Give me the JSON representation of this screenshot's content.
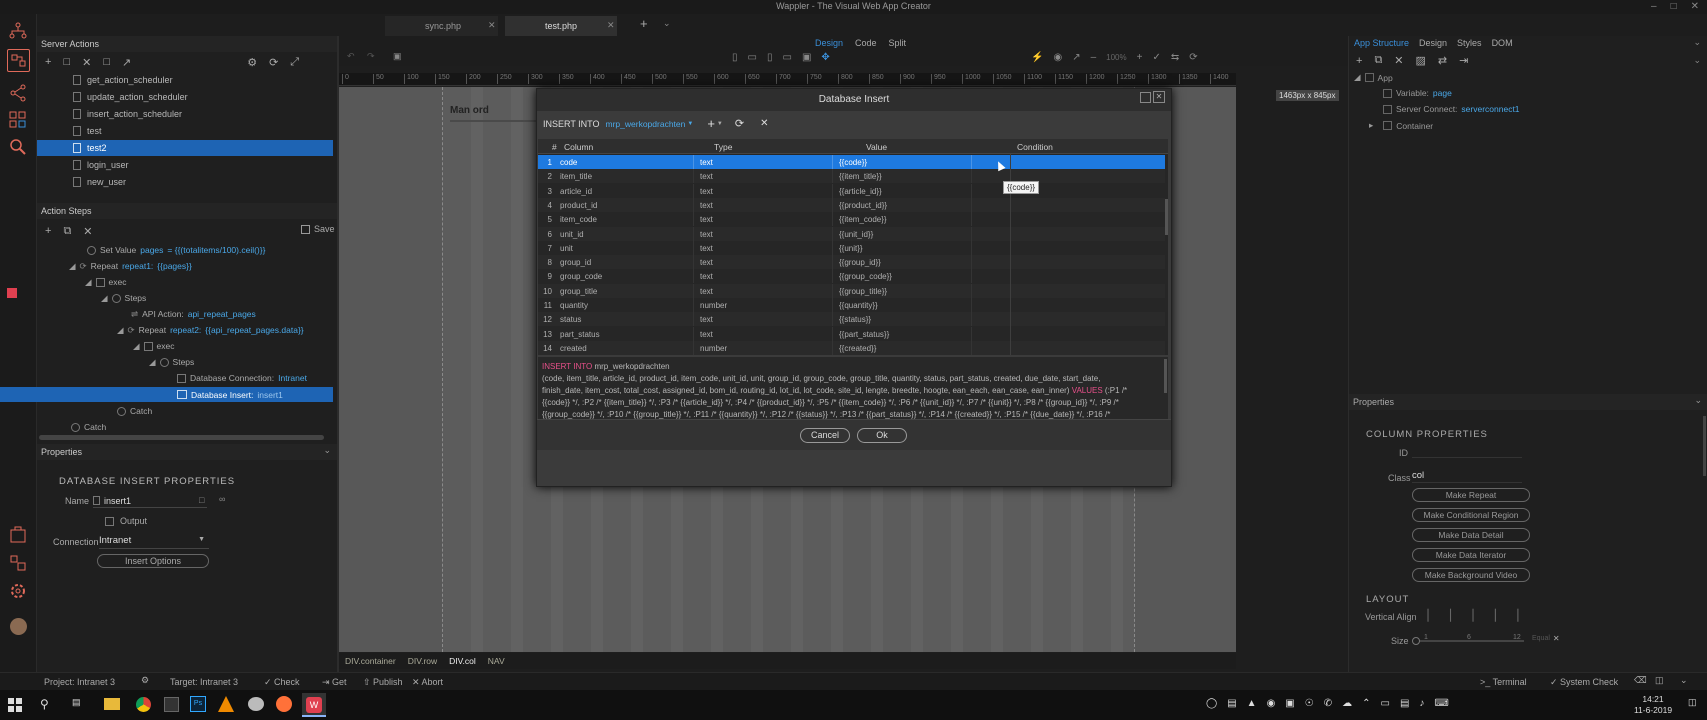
{
  "window": {
    "title": "Wappler - The Visual Web App Creator"
  },
  "tabs": [
    {
      "label": "sync.php"
    },
    {
      "label": "test.php"
    }
  ],
  "left_panel": {
    "title": "Server Actions",
    "tree_items": [
      {
        "label": "get_action_scheduler"
      },
      {
        "label": "update_action_scheduler"
      },
      {
        "label": "insert_action_scheduler"
      },
      {
        "label": "test"
      },
      {
        "label": "test2"
      },
      {
        "label": "login_user"
      },
      {
        "label": "new_user"
      }
    ],
    "action_steps_title": "Action Steps",
    "save_label": "Save",
    "steps": [
      {
        "prefix": "Set Value",
        "name": "pages",
        "expr": "= {{(totalitems/100).ceil()}}"
      },
      {
        "prefix": "Repeat",
        "name": "repeat1:",
        "expr": "{{pages}}"
      },
      {
        "prefix": "exec",
        "name": "",
        "expr": ""
      },
      {
        "prefix": "Steps",
        "name": "",
        "expr": ""
      },
      {
        "prefix": "API Action:",
        "name": "api_repeat_pages",
        "expr": ""
      },
      {
        "prefix": "Repeat",
        "name": "repeat2:",
        "expr": "{{api_repeat_pages.data}}"
      },
      {
        "prefix": "exec",
        "name": "",
        "expr": ""
      },
      {
        "prefix": "Steps",
        "name": "",
        "expr": ""
      },
      {
        "prefix": "Database Connection:",
        "name": "Intranet",
        "expr": ""
      },
      {
        "prefix": "Database Insert:",
        "name": "insert1",
        "expr": ""
      },
      {
        "prefix": "Catch",
        "name": "",
        "expr": ""
      },
      {
        "prefix": "Catch",
        "name": "",
        "expr": ""
      }
    ],
    "properties_title": "Properties",
    "properties_heading": "DATABASE INSERT PROPERTIES",
    "name_label": "Name",
    "name_value": "insert1",
    "output_label": "Output",
    "connection_label": "Connection",
    "connection_value": "Intranet",
    "insert_options_label": "Insert Options"
  },
  "design_toolbar": {
    "design": "Design",
    "code": "Code",
    "split": "Split",
    "zoom": "100%"
  },
  "ruler": {
    "ticks": [
      "0",
      "50",
      "100",
      "150",
      "200",
      "250",
      "300",
      "350",
      "400",
      "450",
      "500",
      "550",
      "600",
      "650",
      "700",
      "750",
      "800",
      "850",
      "900",
      "950",
      "1000",
      "1050",
      "1100",
      "1150",
      "1200",
      "1250",
      "1300",
      "1350",
      "1400"
    ],
    "size_badge": "1463px x 845px"
  },
  "canvas": {
    "heading_fragment": "Man ord"
  },
  "breadcrumb": [
    "DIV.container",
    "DIV.row",
    "DIV.col",
    "NAV"
  ],
  "dialog": {
    "title": "Database Insert",
    "insert_into_label": "INSERT INTO",
    "table_name": "mrp_werkopdrachten",
    "columns": [
      "#",
      "Column",
      "Type",
      "Value",
      "Condition"
    ],
    "rows": [
      {
        "n": "1",
        "column": "code",
        "type": "text",
        "value": "{{code}}"
      },
      {
        "n": "2",
        "column": "item_title",
        "type": "text",
        "value": "{{item_title}}"
      },
      {
        "n": "3",
        "column": "article_id",
        "type": "text",
        "value": "{{article_id}}"
      },
      {
        "n": "4",
        "column": "product_id",
        "type": "text",
        "value": "{{product_id}}"
      },
      {
        "n": "5",
        "column": "item_code",
        "type": "text",
        "value": "{{item_code}}"
      },
      {
        "n": "6",
        "column": "unit_id",
        "type": "text",
        "value": "{{unit_id}}"
      },
      {
        "n": "7",
        "column": "unit",
        "type": "text",
        "value": "{{unit}}"
      },
      {
        "n": "8",
        "column": "group_id",
        "type": "text",
        "value": "{{group_id}}"
      },
      {
        "n": "9",
        "column": "group_code",
        "type": "text",
        "value": "{{group_code}}"
      },
      {
        "n": "10",
        "column": "group_title",
        "type": "text",
        "value": "{{group_title}}"
      },
      {
        "n": "11",
        "column": "quantity",
        "type": "number",
        "value": "{{quantity}}"
      },
      {
        "n": "12",
        "column": "status",
        "type": "text",
        "value": "{{status}}"
      },
      {
        "n": "13",
        "column": "part_status",
        "type": "text",
        "value": "{{part_status}}"
      },
      {
        "n": "14",
        "column": "created",
        "type": "number",
        "value": "{{created}}"
      }
    ],
    "tooltip": "{{code}}",
    "sql": {
      "kw_insert": "INSERT INTO",
      "table": "mrp_werkopdrachten",
      "line2": "(code, item_title, article_id, product_id, item_code, unit_id, unit, group_id, group_code, group_title, quantity, status, part_status, created, due_date, start_date,",
      "line3a": "finish_date, item_cost, total_cost, assigned_id, bom_id, routing_id, lot_id, lot_code, site_id, lengte, breedte, hoogte, ean_each, ean_case, ean_inner)",
      "kw_values": "VALUES",
      "line3b": "(:P1 /*",
      "line4": "{{code}} */, :P2 /* {{item_title}} */, :P3 /* {{article_id}} */, :P4 /* {{product_id}} */, :P5 /* {{item_code}} */, :P6 /* {{unit_id}} */, :P7 /* {{unit}} */, :P8 /* {{group_id}} */, :P9 /*",
      "line5": "{{group_code}} */, :P10 /* {{group_title}} */, :P11 /* {{quantity}} */, :P12 /* {{status}} */, :P13 /* {{part_status}} */, :P14 /* {{created}} */, :P15 /* {{due_date}} */, :P16 /*"
    },
    "cancel_label": "Cancel",
    "ok_label": "Ok"
  },
  "right_panel": {
    "tabs": [
      "App Structure",
      "Design",
      "Styles",
      "DOM"
    ],
    "tree": [
      {
        "prefix": "App",
        "value": ""
      },
      {
        "prefix": "Variable:",
        "value": "page"
      },
      {
        "prefix": "Server Connect:",
        "value": "serverconnect1"
      },
      {
        "prefix": "Container",
        "value": ""
      }
    ],
    "properties_title": "Properties",
    "column_props_heading": "COLUMN PROPERTIES",
    "id_label": "ID",
    "class_label": "Class",
    "class_value": "col",
    "buttons": [
      "Make Repeat",
      "Make Conditional Region",
      "Make Data Detail",
      "Make Data Iterator",
      "Make Background Video"
    ],
    "layout_heading": "LAYOUT",
    "vertical_align_label": "Vertical Align",
    "size_label": "Size",
    "size_ticks": [
      "1",
      "6",
      "12"
    ],
    "size_equal": "Equal"
  },
  "status_bar": {
    "project": "Project: Intranet 3",
    "target": "Target: Intranet 3",
    "check": "Check",
    "get": "Get",
    "publish": "Publish",
    "abort": "Abort",
    "terminal": "Terminal",
    "system_check": "System Check"
  },
  "taskbar": {
    "time": "14:21",
    "date": "11-6-2019"
  },
  "colors": {
    "accent": "#3a8fd9",
    "selection": "#1e64b4",
    "highlight_text": "#e8508a",
    "link": "#4aa8e8",
    "recording": "#e04050"
  }
}
